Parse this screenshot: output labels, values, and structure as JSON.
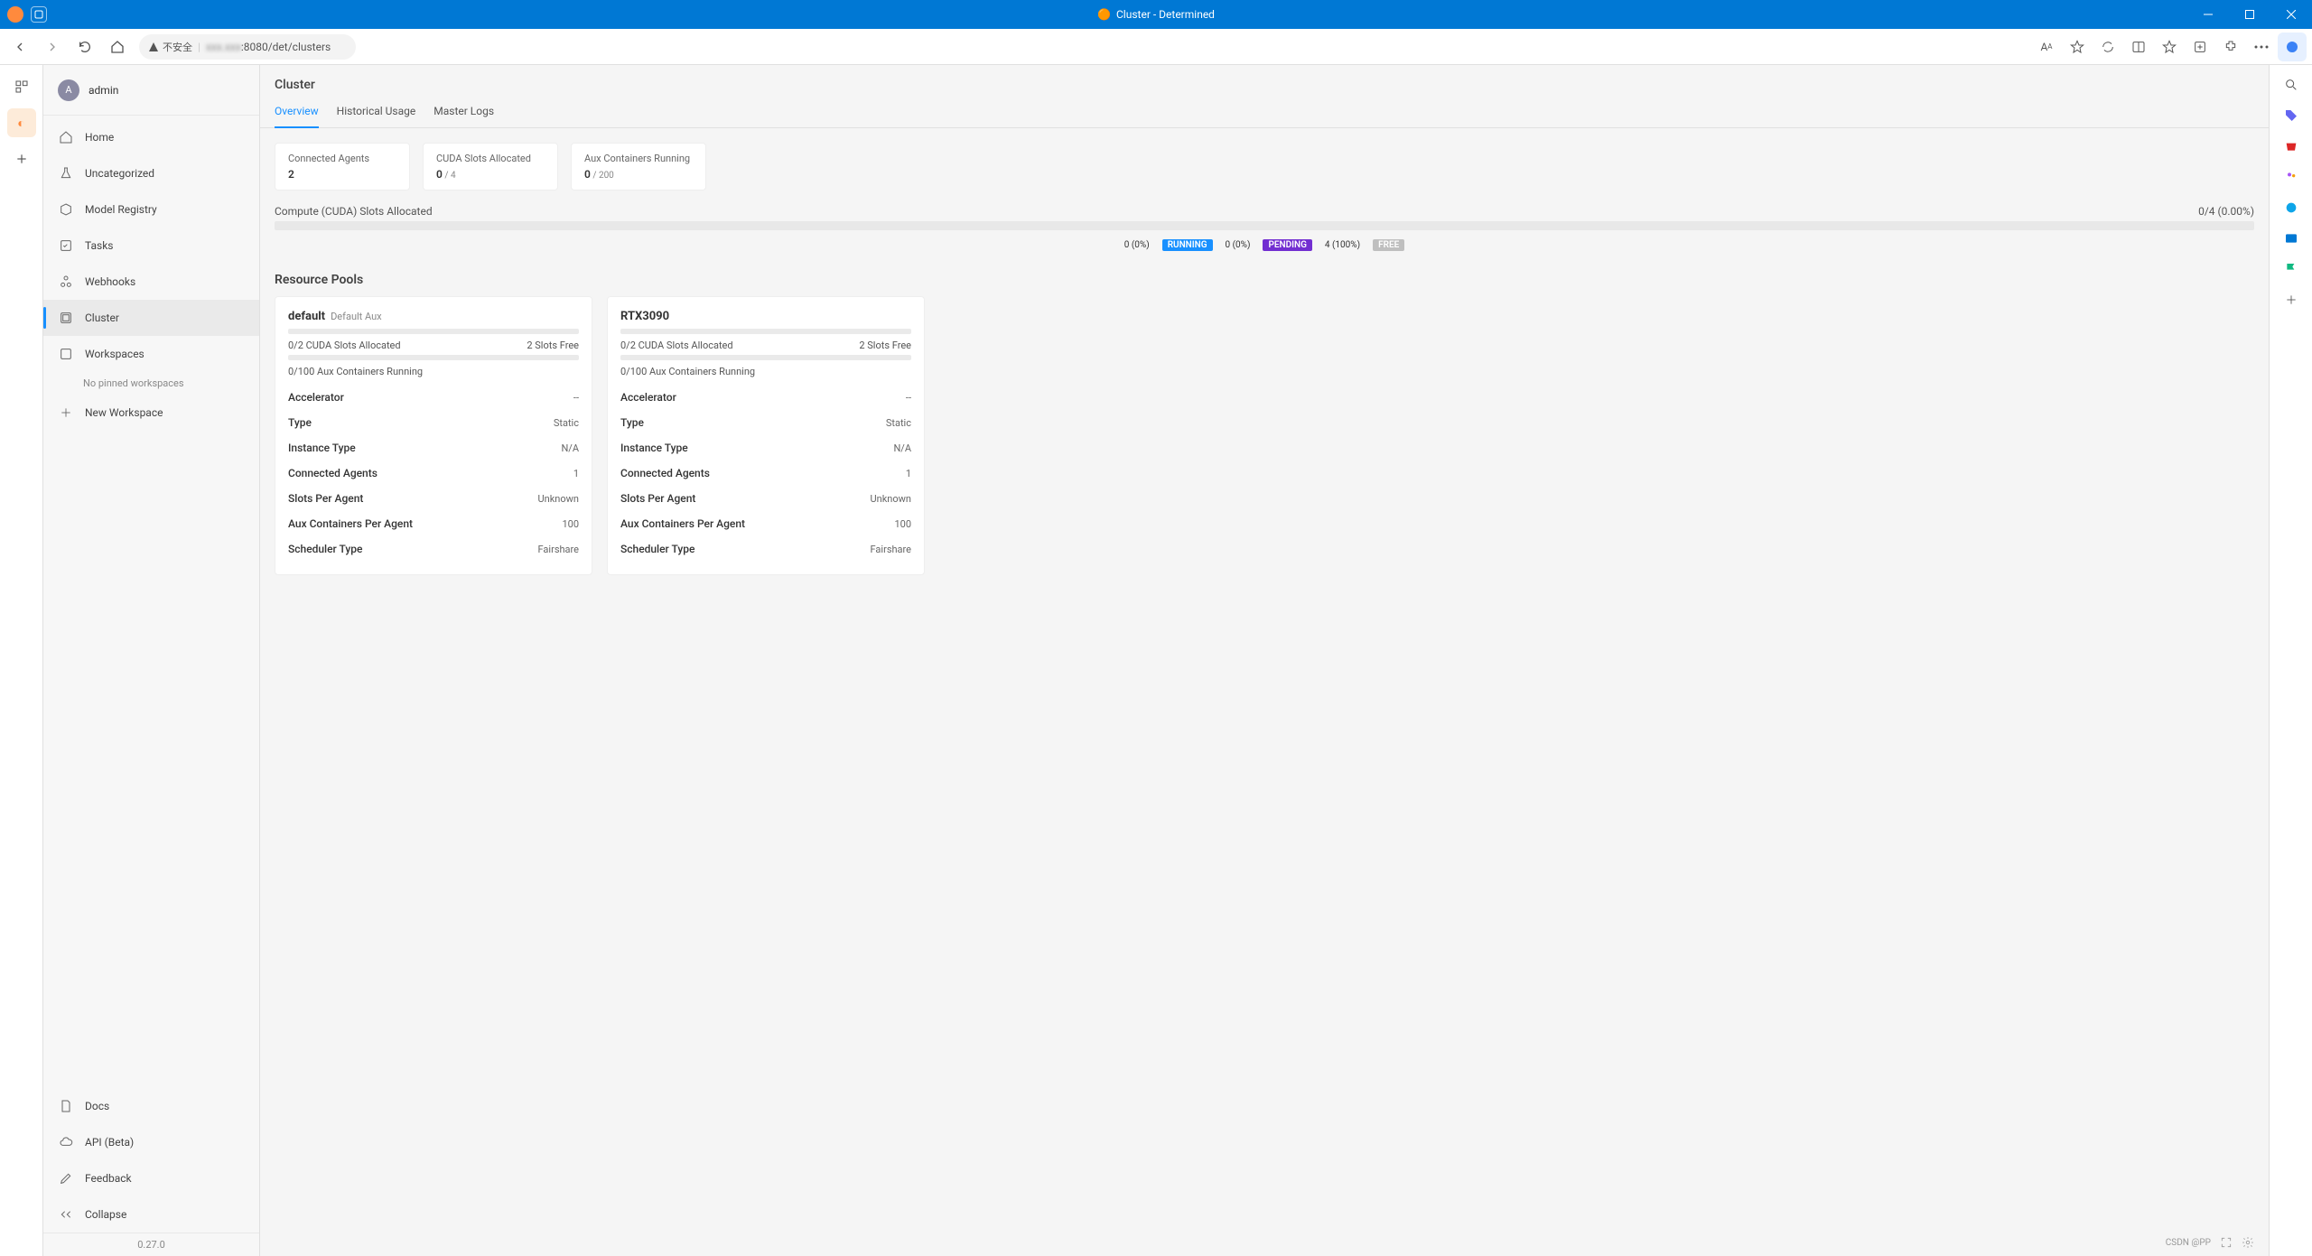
{
  "window": {
    "title": "Cluster - Determined"
  },
  "browser": {
    "security_label": "不安全",
    "url_prefix_hidden": "xxx.xxx",
    "url_suffix": ":8080/det/clusters"
  },
  "sidebar": {
    "user": {
      "initial": "A",
      "name": "admin"
    },
    "items": [
      {
        "label": "Home"
      },
      {
        "label": "Uncategorized"
      },
      {
        "label": "Model Registry"
      },
      {
        "label": "Tasks"
      },
      {
        "label": "Webhooks"
      },
      {
        "label": "Cluster"
      },
      {
        "label": "Workspaces"
      }
    ],
    "no_pinned": "No pinned workspaces",
    "new_workspace": "New Workspace",
    "bottom": [
      {
        "label": "Docs"
      },
      {
        "label": "API (Beta)"
      },
      {
        "label": "Feedback"
      },
      {
        "label": "Collapse"
      }
    ],
    "version": "0.27.0"
  },
  "page": {
    "title": "Cluster",
    "tabs": [
      {
        "label": "Overview"
      },
      {
        "label": "Historical Usage"
      },
      {
        "label": "Master Logs"
      }
    ],
    "stats": [
      {
        "label": "Connected Agents",
        "value": "2",
        "sub": ""
      },
      {
        "label": "CUDA Slots Allocated",
        "value": "0",
        "sub": " / 4"
      },
      {
        "label": "Aux Containers Running",
        "value": "0",
        "sub": " / 200"
      }
    ],
    "allocation": {
      "title": "Compute (CUDA) Slots Allocated",
      "summary": "0/4 (0.00%)",
      "legend": {
        "running_count": "0 (0%)",
        "running_label": "RUNNING",
        "pending_count": "0 (0%)",
        "pending_label": "PENDING",
        "free_count": "4 (100%)",
        "free_label": "FREE"
      }
    },
    "pools_header": "Resource Pools",
    "pools": [
      {
        "title": "default",
        "subtitle": "Default Aux",
        "slots_allocated": "0/2 CUDA Slots Allocated",
        "slots_free": "2 Slots Free",
        "aux_running": "0/100 Aux Containers Running",
        "rows": [
          {
            "label": "Accelerator",
            "value": "--"
          },
          {
            "label": "Type",
            "value": "Static"
          },
          {
            "label": "Instance Type",
            "value": "N/A"
          },
          {
            "label": "Connected Agents",
            "value": "1"
          },
          {
            "label": "Slots Per Agent",
            "value": "Unknown"
          },
          {
            "label": "Aux Containers Per Agent",
            "value": "100"
          },
          {
            "label": "Scheduler Type",
            "value": "Fairshare"
          }
        ]
      },
      {
        "title": "RTX3090",
        "subtitle": "",
        "slots_allocated": "0/2 CUDA Slots Allocated",
        "slots_free": "2 Slots Free",
        "aux_running": "0/100 Aux Containers Running",
        "rows": [
          {
            "label": "Accelerator",
            "value": "--"
          },
          {
            "label": "Type",
            "value": "Static"
          },
          {
            "label": "Instance Type",
            "value": "N/A"
          },
          {
            "label": "Connected Agents",
            "value": "1"
          },
          {
            "label": "Slots Per Agent",
            "value": "Unknown"
          },
          {
            "label": "Aux Containers Per Agent",
            "value": "100"
          },
          {
            "label": "Scheduler Type",
            "value": "Fairshare"
          }
        ]
      }
    ]
  },
  "footer": {
    "watermark": "CSDN @PP"
  }
}
